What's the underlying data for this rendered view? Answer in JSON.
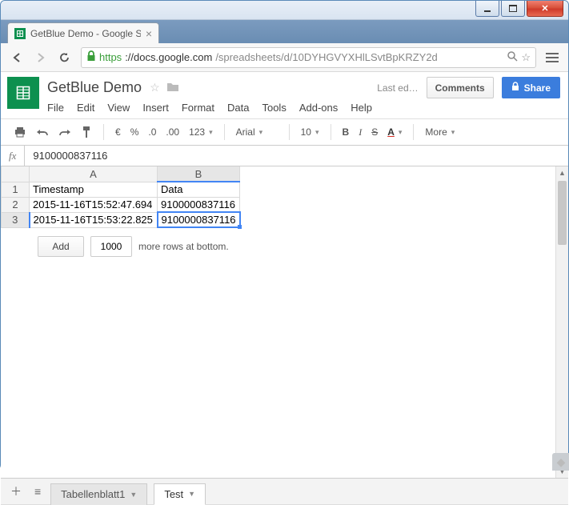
{
  "window": {
    "browser_tab_title": "GetBlue Demo - Google S"
  },
  "url": {
    "scheme": "https",
    "host": "://docs.google.com",
    "path": "/spreadsheets/d/10DYHGVYXHlLSvtBpKRZY2d"
  },
  "doc": {
    "title": "GetBlue Demo",
    "last_edit": "Last ed…"
  },
  "buttons": {
    "comments": "Comments",
    "share": "Share"
  },
  "menu": {
    "file": "File",
    "edit": "Edit",
    "view": "View",
    "insert": "Insert",
    "format": "Format",
    "data": "Data",
    "tools": "Tools",
    "addons": "Add-ons",
    "help": "Help"
  },
  "toolbar": {
    "currency": "€",
    "percent": "%",
    "dec_dec": ".0",
    "dec_inc": ".00",
    "numfmt": "123",
    "font": "Arial",
    "size": "10",
    "more": "More"
  },
  "formula": {
    "value": "9100000837116"
  },
  "columns": {
    "A": "A",
    "B": "B"
  },
  "rows": {
    "header": {
      "A": "Timestamp",
      "B": "Data"
    },
    "r2": {
      "n": "2",
      "A": "2015-11-16T15:52:47.694",
      "B": "9100000837116"
    },
    "r3": {
      "n": "3",
      "A": "2015-11-16T15:53:22.825",
      "B": "9100000837116"
    }
  },
  "addrows": {
    "button": "Add",
    "count": "1000",
    "suffix": "more rows at bottom."
  },
  "tabs": {
    "t1": "Tabellenblatt1",
    "t2": "Test"
  }
}
